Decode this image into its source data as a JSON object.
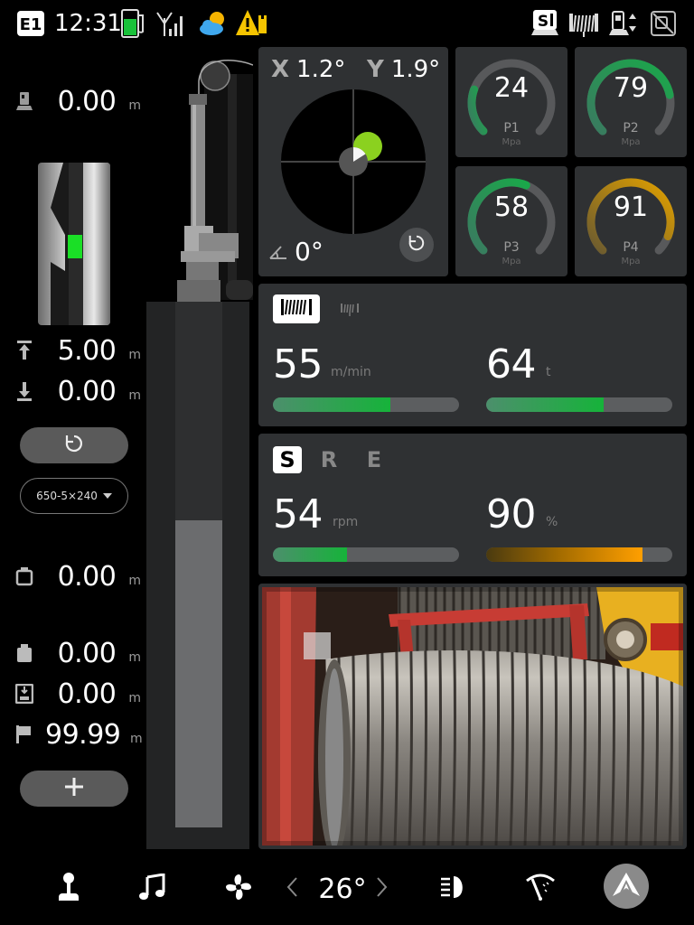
{
  "status_bar": {
    "mode_badge": "E1",
    "time": "12:31",
    "icons": [
      "fuel-icon",
      "signal-icon",
      "weather-icon",
      "warning-icon",
      "s1-icon",
      "winch-icon",
      "drill-icon",
      "no-camera-icon"
    ],
    "colors": {
      "fuel": "#19c23a",
      "warning": "#f5c400",
      "weather_sun": "#f5b300",
      "weather_cloud": "#3fa8ee"
    }
  },
  "left": {
    "depth_top": {
      "value": "0.00",
      "unit": "m",
      "icon": "drill-depth-icon"
    },
    "up": {
      "value": "5.00",
      "unit": "m",
      "icon": "arrow-up-bar-icon"
    },
    "down": {
      "value": "0.00",
      "unit": "m",
      "icon": "arrow-down-bar-icon"
    },
    "reset_icon": "refresh-icon",
    "tool_select": {
      "selected": "650-5×240"
    },
    "r1": {
      "value": "0.00",
      "unit": "m",
      "icon": "bucket-icon"
    },
    "r2": {
      "value": "0.00",
      "unit": "m",
      "icon": "fill-icon"
    },
    "r3": {
      "value": "0.00",
      "unit": "m",
      "icon": "save-depth-icon"
    },
    "r4": {
      "value": "99.99",
      "unit": "m",
      "icon": "flag-icon"
    },
    "add_icon": "plus-icon",
    "borehole_marker_color": "#1adf26"
  },
  "inclinometer": {
    "x_label": "X",
    "x_value": "1.2°",
    "y_label": "Y",
    "y_value": "1.9°",
    "angle_value": "0°",
    "dot_color": "#8bd11f"
  },
  "gauges": [
    {
      "id": "p1",
      "value": "24",
      "label": "P1",
      "unit": "Mpa",
      "level": 0.24,
      "color": "#1aa84a"
    },
    {
      "id": "p2",
      "value": "79",
      "label": "P2",
      "unit": "Mpa",
      "level": 0.79,
      "color": "#1aa84a"
    },
    {
      "id": "p3",
      "value": "58",
      "label": "P3",
      "unit": "Mpa",
      "level": 0.58,
      "color": "#1aa84a"
    },
    {
      "id": "p4",
      "value": "91",
      "label": "P4",
      "unit": "Mpa",
      "level": 0.91,
      "color": "#e0a000"
    }
  ],
  "winch_panel": {
    "speed": {
      "value": "55",
      "unit": "m/min",
      "level": 0.63
    },
    "load": {
      "value": "64",
      "unit": "t",
      "level": 0.63
    },
    "bar_color": "#16b33a"
  },
  "rotary_panel": {
    "modes": [
      "S",
      "R",
      "E"
    ],
    "active_mode": "S",
    "rpm": {
      "value": "54",
      "unit": "rpm",
      "level": 0.4
    },
    "percent": {
      "value": "90",
      "unit": "%",
      "level": 0.84
    },
    "bar_color_green": "#16b33a",
    "bar_color_orange": "#ff9f00"
  },
  "bottom_bar": {
    "items": [
      "joystick-icon",
      "music-icon",
      "fan-icon",
      "headlight-icon",
      "wiper-icon",
      "brand-logo-icon"
    ],
    "temperature": "26°"
  }
}
